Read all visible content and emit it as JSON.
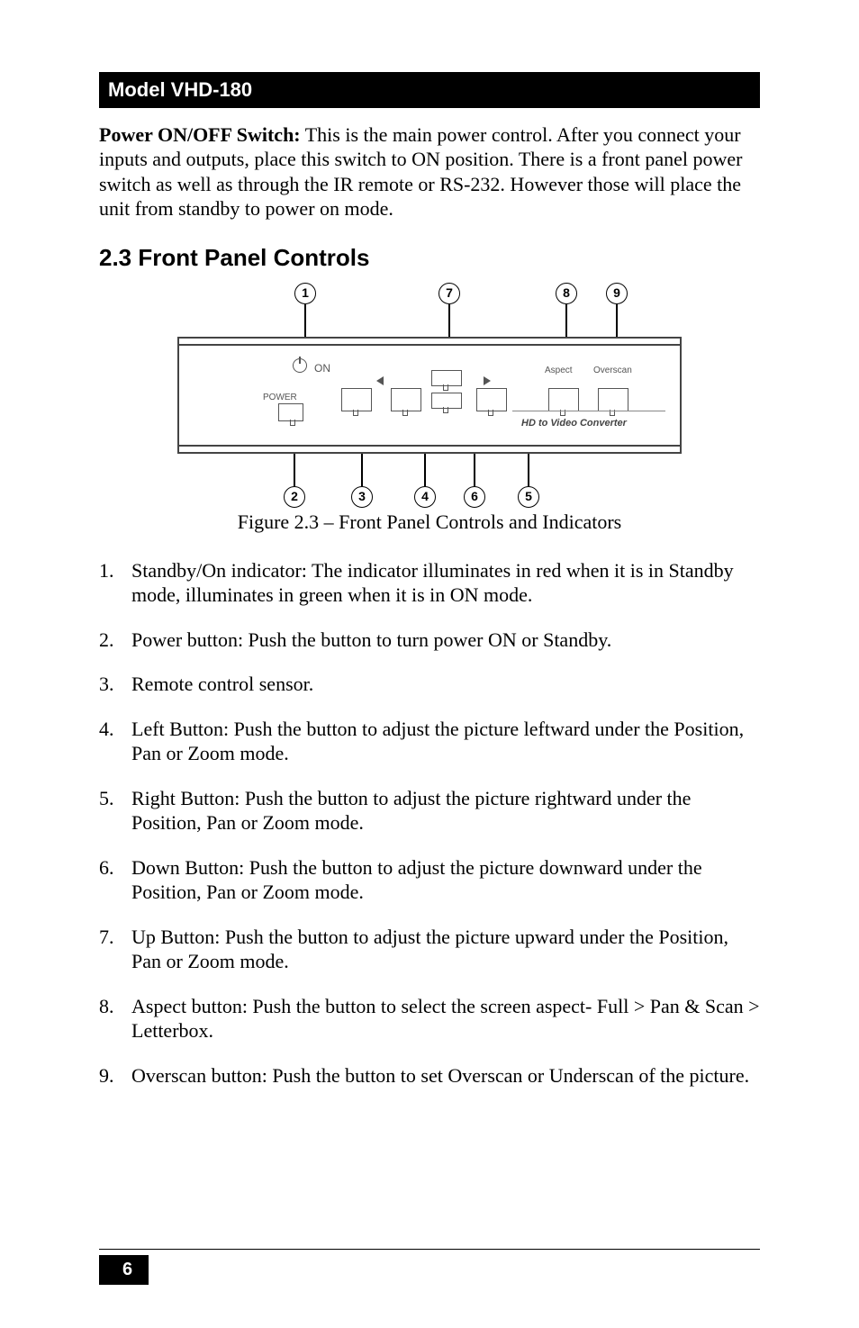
{
  "header": {
    "model": "Model VHD-180"
  },
  "intro": {
    "lead": "Power ON/OFF Switch:",
    "body": " This is the main power control. After you connect your inputs and outputs, place this switch to ON position. There is a front panel power switch as well as through the IR remote or RS-232. However those will place the unit from standby to power on mode."
  },
  "section": {
    "title": "2.3 Front Panel Controls"
  },
  "figure": {
    "caption": "Figure 2.3 – Front Panel Controls and Indicators",
    "callouts_top": [
      "1",
      "7",
      "8",
      "9"
    ],
    "callouts_bottom": [
      "2",
      "3",
      "4",
      "6",
      "5"
    ],
    "labels": {
      "on": "ON",
      "power": "POWER",
      "aspect": "Aspect",
      "overscan": "Overscan",
      "device": "HD to Video Converter"
    }
  },
  "items": [
    {
      "num": "1.",
      "text": "Standby/On indicator: The indicator illuminates in red when it is in Standby mode, illuminates in green when it is in ON mode."
    },
    {
      "num": "2.",
      "text": "Power button: Push the button to turn power ON or Standby."
    },
    {
      "num": "3.",
      "text": "Remote control sensor."
    },
    {
      "num": "4.",
      "text": "Left Button: Push the button to adjust the picture leftward under the Position, Pan or Zoom mode."
    },
    {
      "num": "5.",
      "text": "Right Button: Push the button to adjust the picture rightward under the Position, Pan or Zoom mode."
    },
    {
      "num": "6.",
      "text": "Down Button: Push the button to adjust the picture downward under the Position, Pan or Zoom mode."
    },
    {
      "num": "7.",
      "text": "Up Button: Push the button to adjust the picture upward under the Position, Pan or Zoom mode."
    },
    {
      "num": "8.",
      "text": "Aspect button: Push the button to select the screen aspect- Full > Pan & Scan > Letterbox."
    },
    {
      "num": "9.",
      "text": "Overscan button: Push the button to set Overscan or Underscan of the picture."
    }
  ],
  "footer": {
    "page": "6"
  }
}
